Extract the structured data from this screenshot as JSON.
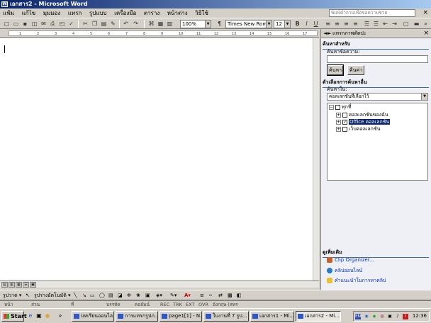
{
  "window": {
    "title": "เอกสาร2 - Microsoft Word"
  },
  "menubar": {
    "items": [
      {
        "name": "file",
        "label": "แฟ้ม"
      },
      {
        "name": "edit",
        "label": "แก้ไข"
      },
      {
        "name": "view",
        "label": "มุมมอง"
      },
      {
        "name": "insert",
        "label": "แทรก"
      },
      {
        "name": "format",
        "label": "รูปแบบ"
      },
      {
        "name": "tools",
        "label": "เครื่องมือ"
      },
      {
        "name": "table",
        "label": "ตาราง"
      },
      {
        "name": "window",
        "label": "หน้าต่าง"
      },
      {
        "name": "help",
        "label": "วิธีใช้"
      }
    ],
    "help_placeholder": "พิมพ์คำถามเพื่อขอความช่วย",
    "close_glyph": "×"
  },
  "toolbar": {
    "zoom": "100%",
    "style": "Times New Roman",
    "font_size": "12",
    "bold": "B",
    "italic": "I",
    "underline": "U"
  },
  "ruler": {
    "marks": [
      "1",
      "2",
      "3",
      "4",
      "5",
      "6",
      "7",
      "8",
      "9",
      "10",
      "11",
      "12",
      "13",
      "14",
      "15",
      "16",
      "17"
    ]
  },
  "taskpane": {
    "title": "แทรกภาพตัดปะ",
    "back": "◄",
    "forward": "►",
    "close": "×",
    "search_section": "ค้นหาสำหรับ",
    "search_label": "ค้นหาข้อความ:",
    "search_value": "",
    "search_button": "ค้นหา",
    "restore_button": "คืนค่า",
    "options_section": "ตัวเลือกการค้นหาอื่น",
    "search_in_label": "ค้นหาใน:",
    "search_in_value": "คอลเลกชันที่เลือกไว้",
    "tree": {
      "root": "ทุกที่",
      "children": [
        "คอลเลกชันของฉัน",
        "Office คอลเลกชัน",
        "เว็บคอลเลกชัน"
      ]
    },
    "see_also": "ดูเพิ่มเติม",
    "links": [
      "Clip Organizer...",
      "คลิปออนไลน์",
      "คำแนะนำในการหาคลิป"
    ]
  },
  "drawbar": {
    "draw": "รูปวาด",
    "autoshapes": "รูปร่างอัตโนมัติ"
  },
  "statusbar": {
    "page": "หน้า",
    "section": "ส่วน",
    "position": "ที่",
    "line": "บรรทัด",
    "column": "คอลัมน์",
    "rec": "REC",
    "trk": "TRK",
    "ext": "EXT",
    "ovr": "OVR",
    "lang": "อังกฤษ (สหร"
  },
  "taskbar": {
    "start": "Start",
    "buttons": [
      "บทเรียนออนไล...",
      "การแทรกรูปภ...",
      "page1[1] - N...",
      "ใบงานที่ 7 รูป...",
      "เอกสาร1 - Mi...",
      "เอกสาร2 - Mi..."
    ],
    "tray_lang": "EN",
    "clock": "12:36"
  },
  "colors": {
    "title_start": "#0a246a",
    "title_end": "#a6caf0",
    "selection": "#0a246a",
    "link": "#0033cc"
  }
}
